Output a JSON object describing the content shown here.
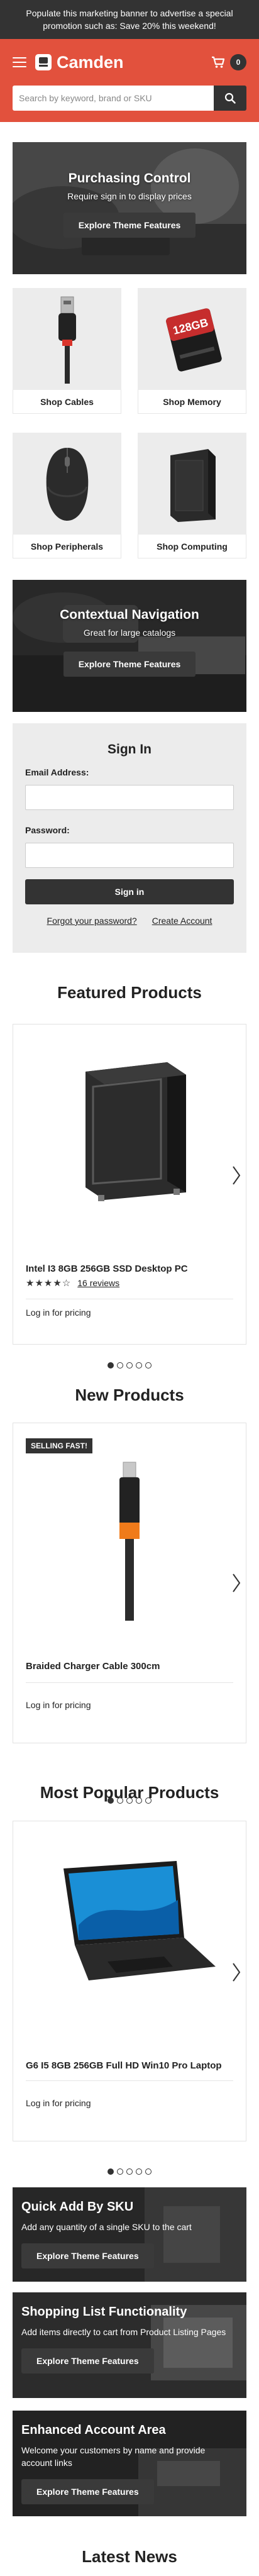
{
  "promo": {
    "text": "Populate this marketing banner to advertise a special promotion such as: Save 20% this weekend!"
  },
  "header": {
    "logo_text": "Camden",
    "cart_count": "0",
    "search_placeholder": "Search by keyword, brand or SKU",
    "brand_color": "#e2513d"
  },
  "banners": [
    {
      "title": "Purchasing Control",
      "subtitle": "Require sign in to display prices",
      "button": "Explore Theme Features"
    },
    {
      "title": "Contextual Navigation",
      "subtitle": "Great for large catalogs",
      "button": "Explore Theme Features"
    }
  ],
  "categories": [
    {
      "label": "Shop Cables",
      "icon": "usb-cable-icon"
    },
    {
      "label": "Shop Memory",
      "icon": "memory-card-icon",
      "card_text": "128GB"
    },
    {
      "label": "Shop Peripherals",
      "icon": "mouse-icon"
    },
    {
      "label": "Shop Computing",
      "icon": "desktop-tower-icon"
    }
  ],
  "signin": {
    "title": "Sign In",
    "email_label": "Email Address:",
    "password_label": "Password:",
    "button": "Sign in",
    "forgot": "Forgot your password?",
    "create": "Create Account"
  },
  "featured": {
    "title": "Featured Products",
    "product": {
      "name": "Intel I3 8GB 256GB SSD Desktop PC",
      "stars": "★★★★☆",
      "rating": 4,
      "reviews": "16 reviews",
      "pricing": "Log in for pricing"
    },
    "active_dot": 1,
    "dot_count": 5
  },
  "new_products": {
    "title": "New Products",
    "product": {
      "badge": "SELLING FAST!",
      "name": "Braided Charger Cable 300cm",
      "pricing": "Log in for pricing"
    },
    "active_dot": 1,
    "dot_count": 5
  },
  "popular": {
    "title": "Most Popular Products",
    "product": {
      "name": "G6 I5 8GB 256GB Full HD Win10 Pro Laptop",
      "pricing": "Log in for pricing"
    },
    "active_dot": 1,
    "dot_count": 5
  },
  "features": [
    {
      "title": "Quick Add By SKU",
      "text": "Add any quantity of a single SKU to the cart",
      "button": "Explore Theme Features"
    },
    {
      "title": "Shopping List Functionality",
      "text": "Add items directly to cart from Product Listing Pages",
      "button": "Explore Theme Features"
    },
    {
      "title": "Enhanced Account Area",
      "text": "Welcome your customers by name and provide account links",
      "button": "Explore Theme Features"
    }
  ],
  "news": {
    "title": "Latest News"
  }
}
